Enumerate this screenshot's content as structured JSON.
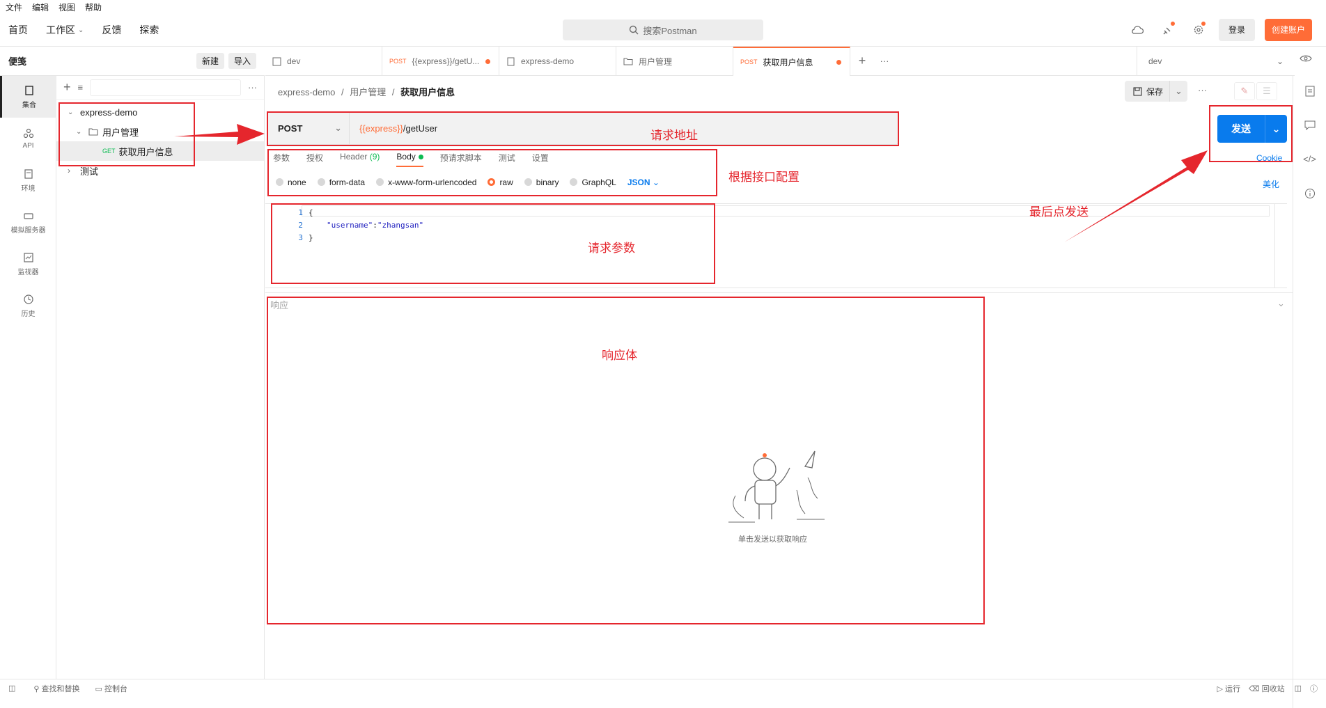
{
  "menu": [
    "文件",
    "编辑",
    "视图",
    "帮助"
  ],
  "nav": {
    "home": "首页",
    "workspace": "工作区",
    "feedback": "反馈",
    "explore": "探索"
  },
  "search": {
    "placeholder": "搜索Postman"
  },
  "auth": {
    "login": "登录",
    "signup": "创建账户"
  },
  "sidebar": {
    "title": "便笺",
    "new": "新建",
    "import": "导入",
    "rail": [
      "集合",
      "API",
      "环境",
      "模拟服务器",
      "监视器",
      "历史"
    ],
    "tree": {
      "collection": "express-demo",
      "folder": "用户管理",
      "request_method": "GET",
      "request": "获取用户信息",
      "other": "测试"
    }
  },
  "tabs": [
    {
      "method": "",
      "label": "dev"
    },
    {
      "method": "POST",
      "label": "{{express}}/getU..."
    },
    {
      "method": "",
      "label": "express-demo"
    },
    {
      "method": "",
      "label": "用户管理"
    },
    {
      "method": "POST",
      "label": "获取用户信息"
    }
  ],
  "env": {
    "selected": "dev"
  },
  "breadcrumb": {
    "a": "express-demo",
    "sep": "/",
    "b": "用户管理",
    "c": "获取用户信息"
  },
  "save": "保存",
  "request": {
    "method": "POST",
    "url_var": "{{express}}",
    "url_path": "/getUser",
    "send": "发送"
  },
  "req_tabs": {
    "params": "参数",
    "auth": "授权",
    "header": "Header",
    "header_count": "(9)",
    "body": "Body",
    "pre": "预请求脚本",
    "tests": "测试",
    "settings": "设置"
  },
  "body_opts": {
    "none": "none",
    "form": "form-data",
    "urlenc": "x-www-form-urlencoded",
    "raw": "raw",
    "binary": "binary",
    "graphql": "GraphQL",
    "json": "JSON"
  },
  "cookie": "Cookie",
  "beautify": "美化",
  "editor": {
    "l1": "1",
    "l2": "2",
    "l3": "3",
    "c1": "{",
    "c2_key": "\"username\"",
    "c2_colon": ":",
    "c2_val": "\"zhangsan\"",
    "c3": "}"
  },
  "response": {
    "title": "响应",
    "empty": "单击发送以获取响应"
  },
  "status": {
    "find": "查找和替换",
    "console": "控制台",
    "runner": "运行",
    "trash": "回收站"
  },
  "annotations": {
    "url": "请求地址",
    "config": "根据接口配置",
    "send": "最后点发送",
    "params": "请求参数",
    "body": "响应体"
  }
}
